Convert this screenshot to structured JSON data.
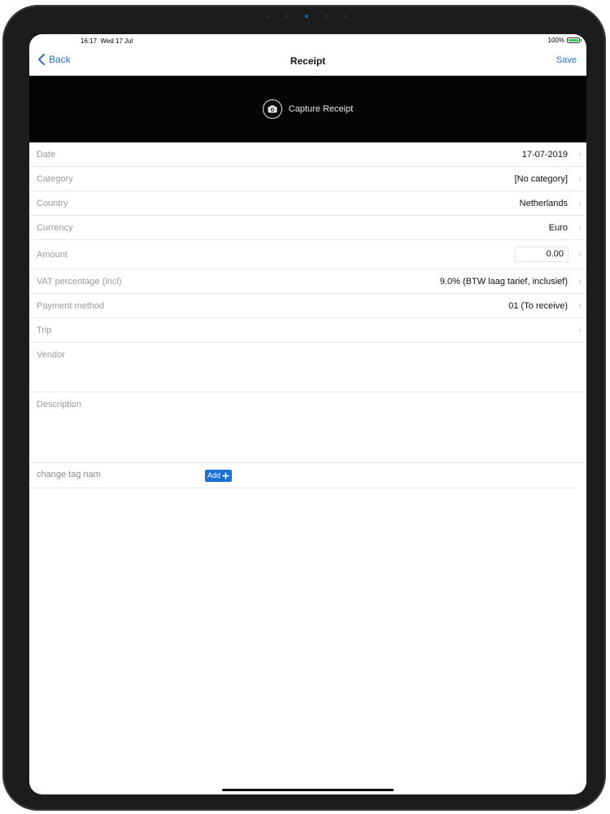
{
  "status": {
    "time": "16:17",
    "date": "Wed 17 Jul",
    "battery": "100%"
  },
  "nav": {
    "back_label": "Back",
    "title": "Receipt",
    "save_label": "Save"
  },
  "capture": {
    "label": "Capture Receipt",
    "icon": "camera-icon"
  },
  "fields": {
    "date": {
      "label": "Date",
      "value": "17-07-2019"
    },
    "category": {
      "label": "Category",
      "value": "[No category]"
    },
    "country": {
      "label": "Country",
      "value": "Netherlands"
    },
    "currency": {
      "label": "Currency",
      "value": "Euro"
    },
    "amount": {
      "label": "Amount",
      "value": "0.00"
    },
    "vat": {
      "label": "VAT percentage (incl)",
      "value": "9.0% (BTW laag tarief, inclusief)"
    },
    "payment": {
      "label": "Payment method",
      "value": "01 (To receive)"
    },
    "trip": {
      "label": "Trip",
      "value": ""
    },
    "vendor": {
      "label": "Vendor"
    },
    "description": {
      "label": "Description"
    }
  },
  "tags": {
    "label": "change tag nam",
    "add_label": "Add"
  },
  "colors": {
    "accent": "#2c6fb7",
    "add_button": "#1a73d0",
    "capture_bg": "#050505"
  }
}
